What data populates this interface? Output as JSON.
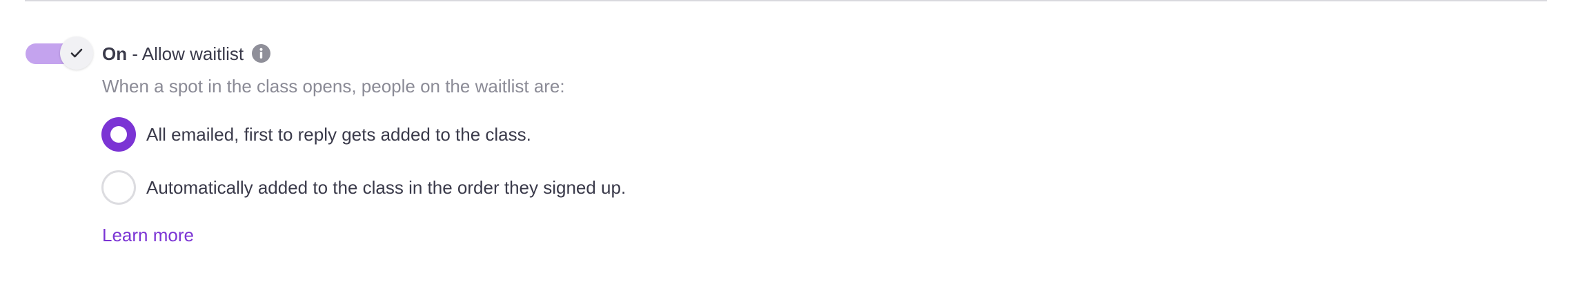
{
  "waitlist": {
    "toggle_state": "On",
    "toggle_label": " - Allow waitlist",
    "toggle_on": true,
    "description": "When a spot in the class opens, people on the waitlist are:",
    "options": [
      {
        "label": "All emailed, first to reply gets added to the class.",
        "selected": true
      },
      {
        "label": "Automatically added to the class in the order they signed up.",
        "selected": false
      }
    ],
    "learn_more": "Learn more"
  },
  "colors": {
    "accent": "#7b34d4",
    "toggle_track": "#c4a3ee",
    "text": "#3a3a4a",
    "muted_text": "#8b8b96"
  },
  "icons": {
    "toggle_knob": "checkmark-icon",
    "info": "info-icon"
  }
}
